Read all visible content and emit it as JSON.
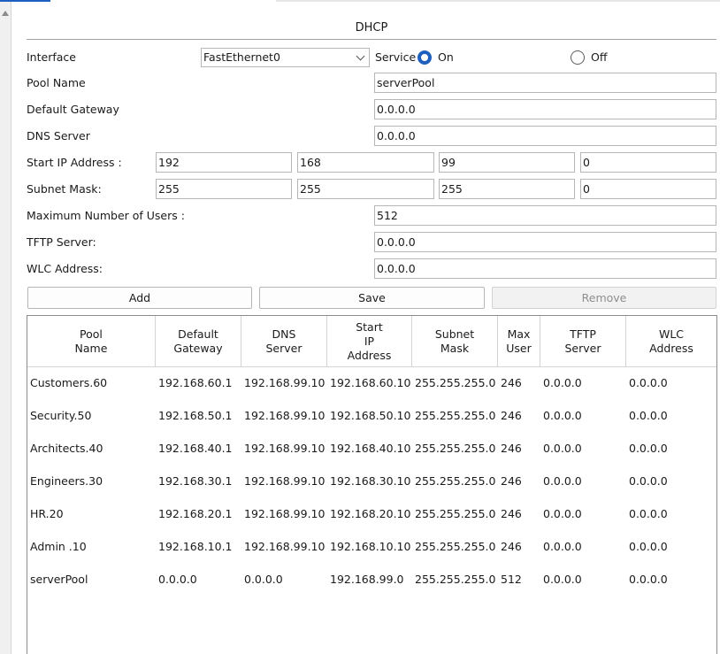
{
  "dialog": {
    "title": "DHCP"
  },
  "form": {
    "interface_label": "Interface",
    "interface_value": "FastEthernet0",
    "service_label": "Service",
    "on_label": "On",
    "off_label": "Off",
    "service_state": "On",
    "pool_name_label": "Pool Name",
    "pool_name_value": "serverPool",
    "gateway_label": "Default Gateway",
    "gateway_value": "0.0.0.0",
    "dns_label": "DNS Server",
    "dns_value": "0.0.0.0",
    "start_ip_label": "Start IP Address :",
    "start_ip": [
      "192",
      "168",
      "99",
      "0"
    ],
    "subnet_label": "Subnet Mask:",
    "subnet": [
      "255",
      "255",
      "255",
      "0"
    ],
    "max_users_label": "Maximum Number of Users :",
    "max_users_value": "512",
    "tftp_label": "TFTP Server:",
    "tftp_value": "0.0.0.0",
    "wlc_label": "WLC Address:",
    "wlc_value": "0.0.0.0"
  },
  "buttons": {
    "add": "Add",
    "save": "Save",
    "remove": "Remove"
  },
  "table": {
    "headers": [
      [
        "Pool",
        "Name"
      ],
      [
        "Default",
        "Gateway"
      ],
      [
        "DNS",
        "Server"
      ],
      [
        "Start",
        "IP",
        "Address"
      ],
      [
        "Subnet",
        "Mask"
      ],
      [
        "Max",
        "User"
      ],
      [
        "TFTP",
        "Server"
      ],
      [
        "WLC",
        "Address"
      ]
    ],
    "rows": [
      [
        "Customers.60",
        "192.168.60.1",
        "192.168.99.10",
        "192.168.60.10",
        "255.255.255.0",
        "246",
        "0.0.0.0",
        "0.0.0.0"
      ],
      [
        "Security.50",
        "192.168.50.1",
        "192.168.99.10",
        "192.168.50.10",
        "255.255.255.0",
        "246",
        "0.0.0.0",
        "0.0.0.0"
      ],
      [
        "Architects.40",
        "192.168.40.1",
        "192.168.99.10",
        "192.168.40.10",
        "255.255.255.0",
        "246",
        "0.0.0.0",
        "0.0.0.0"
      ],
      [
        "Engineers.30",
        "192.168.30.1",
        "192.168.99.10",
        "192.168.30.10",
        "255.255.255.0",
        "246",
        "0.0.0.0",
        "0.0.0.0"
      ],
      [
        "HR.20",
        "192.168.20.1",
        "192.168.99.10",
        "192.168.20.10",
        "255.255.255.0",
        "246",
        "0.0.0.0",
        "0.0.0.0"
      ],
      [
        "Admin .10",
        "192.168.10.1",
        "192.168.99.10",
        "192.168.10.10",
        "255.255.255.0",
        "246",
        "0.0.0.0",
        "0.0.0.0"
      ],
      [
        "serverPool",
        "0.0.0.0",
        "0.0.0.0",
        "192.168.99.0",
        "255.255.255.0",
        "512",
        "0.0.0.0",
        "0.0.0.0"
      ]
    ]
  },
  "colors": {
    "accent": "#1f5fbf",
    "disabled_text": "#8e8e8e"
  }
}
